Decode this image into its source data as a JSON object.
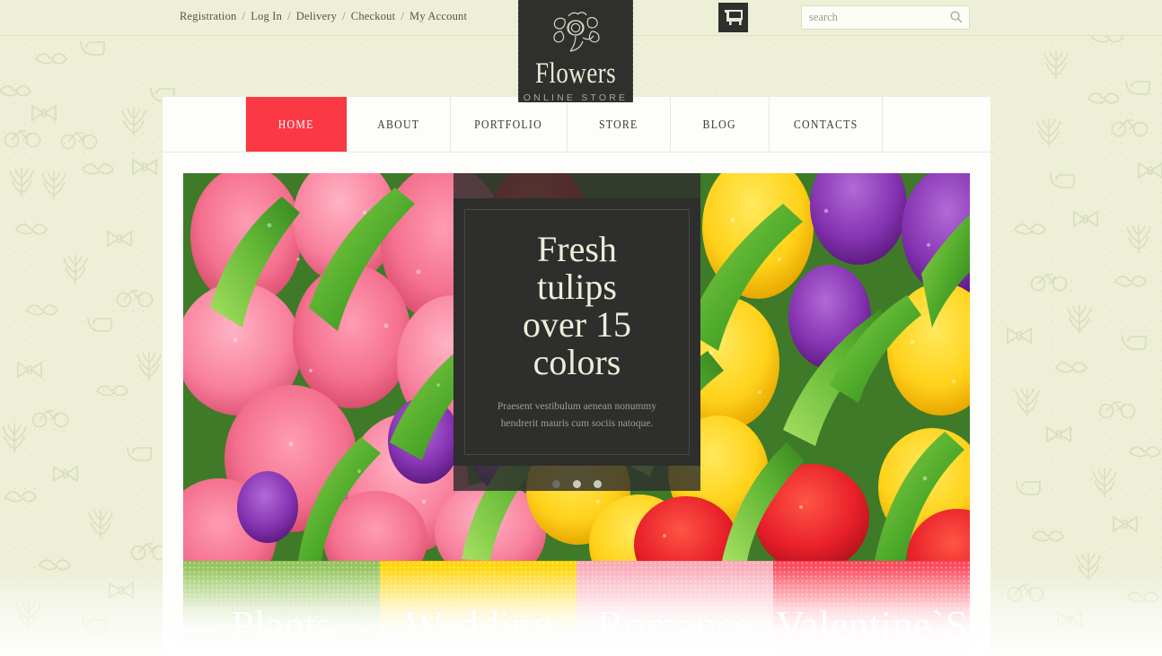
{
  "topbar": {
    "links": [
      {
        "label": "Registration"
      },
      {
        "label": "Log In"
      },
      {
        "label": "Delivery"
      },
      {
        "label": "Checkout"
      },
      {
        "label": "My Account"
      }
    ],
    "separator": "/",
    "cart_icon": "shopping-cart-icon",
    "search": {
      "placeholder": "search",
      "value": "",
      "icon": "magnifier-icon"
    }
  },
  "logo": {
    "name": "Flowers",
    "subtitle": "ONLINE STORE",
    "icon": "rose-bouquet-icon"
  },
  "mainnav": {
    "items": [
      {
        "label": "HOME",
        "active": true
      },
      {
        "label": "ABOUT",
        "active": false
      },
      {
        "label": "PORTFOLIO",
        "active": false
      },
      {
        "label": "STORE",
        "active": false
      },
      {
        "label": "BLOG",
        "active": false
      },
      {
        "label": "CONTACTS",
        "active": false
      }
    ],
    "active_color": "#fa3944"
  },
  "hero": {
    "title_line1": "Fresh",
    "title_line2": "tulips",
    "title_line3": "over 15",
    "title_line4": "colors",
    "text_line1": "Praesent vestibulum aenean nonummy",
    "text_line2": "hendrerit mauris cum sociis natoque.",
    "slides": [
      {
        "active": true
      },
      {
        "active": false
      },
      {
        "active": false
      }
    ],
    "image_alt": "pink purple yellow and red tulips with dew drops"
  },
  "categories": [
    {
      "label": "Plants",
      "color": "#8fc258"
    },
    {
      "label": "Wedding",
      "color": "#ffd400"
    },
    {
      "label": "Romance",
      "color": "#f9a7b6"
    },
    {
      "label": "Valentine`S",
      "color": "#fb4457"
    }
  ],
  "theme": {
    "page_background": "#edefd6",
    "container_background": "#fdfdfb",
    "dark": "#2f2f2e",
    "accent_red": "#fa3944",
    "cream_text": "#edeeda"
  }
}
